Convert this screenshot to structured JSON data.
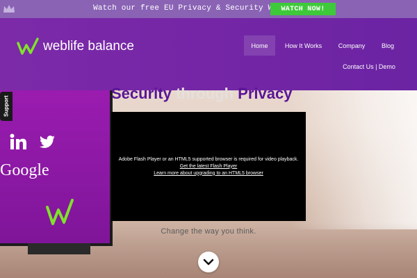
{
  "banner": {
    "text": "Watch our free EU Privacy & Security Webinar!",
    "button_label": "WATCH NOW!",
    "button_color": "#3ec93a",
    "background_color": "#8a63b5"
  },
  "header": {
    "logo_text": "weblife balance",
    "nav": {
      "home": "Home",
      "how_it_works": "How It Works",
      "company": "Company",
      "blog": "Blog",
      "contact_demo": "Contact Us | Demo"
    },
    "accent_color": "#7426a6"
  },
  "side": {
    "support_label": "Support",
    "google_text": "Google"
  },
  "main": {
    "headline_part1": "Security",
    "headline_part2": "through",
    "headline_part3": "Privacy",
    "video": {
      "message": "Adobe Flash Player or an HTML5 supported browser is required for video playback.",
      "link1": "Get the latest Flash Player",
      "link2": "Learn more about upgrading to an HTML5 browser"
    },
    "tagline": "Change the way you think."
  },
  "icons": {
    "crown": "crown-icon",
    "linkedin": "linkedin-icon",
    "twitter": "twitter-icon",
    "logo": "logo-mark-icon",
    "scroll": "chevron-down-icon"
  }
}
